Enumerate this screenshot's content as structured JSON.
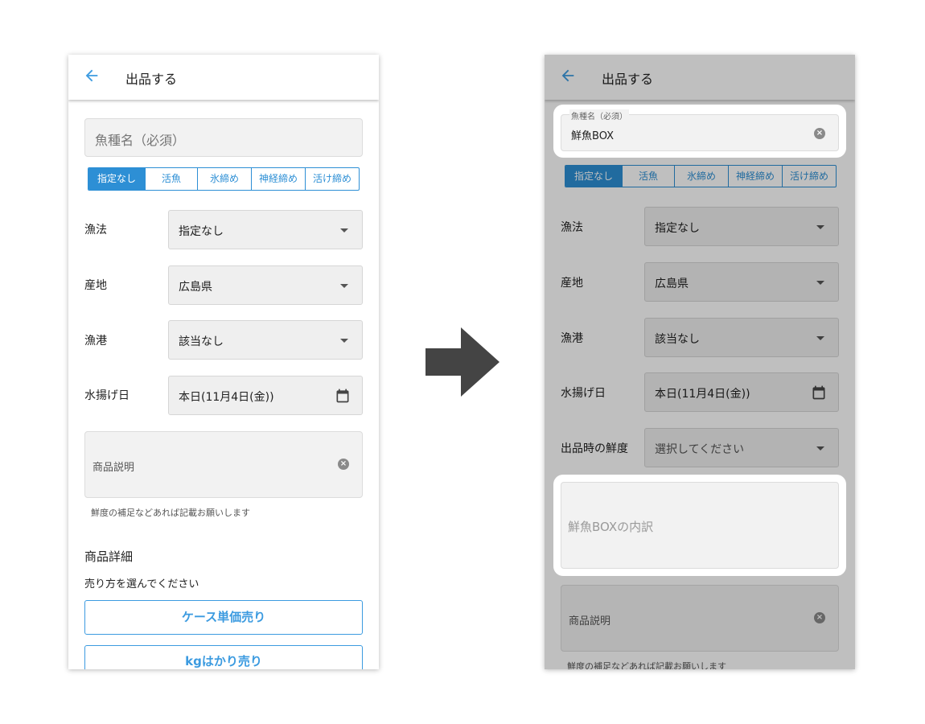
{
  "left": {
    "appbar": {
      "title": "出品する"
    },
    "fish_name_placeholder": "魚種名（必須）",
    "treatment_tabs": [
      "指定なし",
      "活魚",
      "氷締め",
      "神経締め",
      "活け締め"
    ],
    "rows": [
      {
        "label": "漁法",
        "value": "指定なし"
      },
      {
        "label": "産地",
        "value": "広島県"
      },
      {
        "label": "漁港",
        "value": "該当なし"
      },
      {
        "label": "水揚げ日",
        "value": "本日(11月4日(金))"
      }
    ],
    "description_placeholder": "商品説明",
    "description_hint": "鮮度の補足などあれば記載お願いします",
    "details_heading": "商品詳細",
    "sale_method_prompt": "売り方を選んでください",
    "case_button": "ケース単価売り",
    "kg_button": "kgはかり売り"
  },
  "right": {
    "appbar": {
      "title": "出品する"
    },
    "fish_name_label": "魚種名（必須）",
    "fish_name_value": "鮮魚BOX",
    "treatment_tabs": [
      "指定なし",
      "活魚",
      "氷締め",
      "神経締め",
      "活け締め"
    ],
    "rows": [
      {
        "label": "漁法",
        "value": "指定なし"
      },
      {
        "label": "産地",
        "value": "広島県"
      },
      {
        "label": "漁港",
        "value": "該当なし"
      },
      {
        "label": "水揚げ日",
        "value": "本日(11月4日(金))"
      },
      {
        "label": "出品時の鮮度",
        "value": "選択してください"
      }
    ],
    "breakdown_placeholder": "鮮魚BOXの内訳",
    "description_placeholder": "商品説明",
    "description_hint": "鮮度の補足などあれば記載お願いします"
  },
  "icons": {
    "back": "arrow-left-icon",
    "transition": "arrow-right-icon",
    "calendar": "calendar-icon",
    "clear": "clear-circle-icon",
    "dropdown": "caret-down-icon"
  },
  "colors": {
    "accent": "#2d8fd5",
    "button_outline": "#3c9be0",
    "field_bg": "#f2f2f2",
    "arrow": "#444444"
  }
}
